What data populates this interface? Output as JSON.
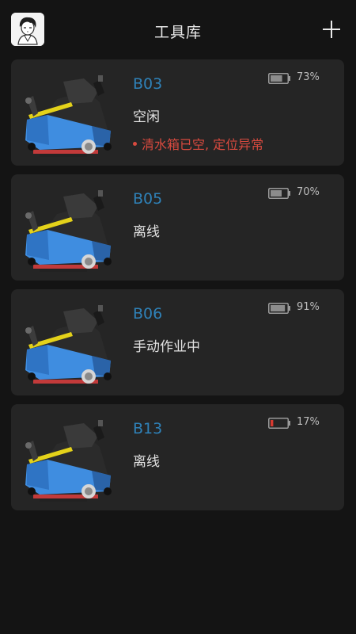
{
  "header": {
    "title": "工具库"
  },
  "colors": {
    "accent": "#2f82b9",
    "alert": "#d94a3f",
    "battery_normal": "#8c8c8c",
    "battery_low": "#d83a30"
  },
  "devices": [
    {
      "name": "B03",
      "status": "空闲",
      "alert": "清水箱已空, 定位异常",
      "battery_label": "73%",
      "battery_level": 0.73
    },
    {
      "name": "B05",
      "status": "离线",
      "battery_label": "70%",
      "battery_level": 0.7
    },
    {
      "name": "B06",
      "status": "手动作业中",
      "battery_label": "91%",
      "battery_level": 0.91
    },
    {
      "name": "B13",
      "status": "离线",
      "battery_label": "17%",
      "battery_level": 0.17
    }
  ]
}
